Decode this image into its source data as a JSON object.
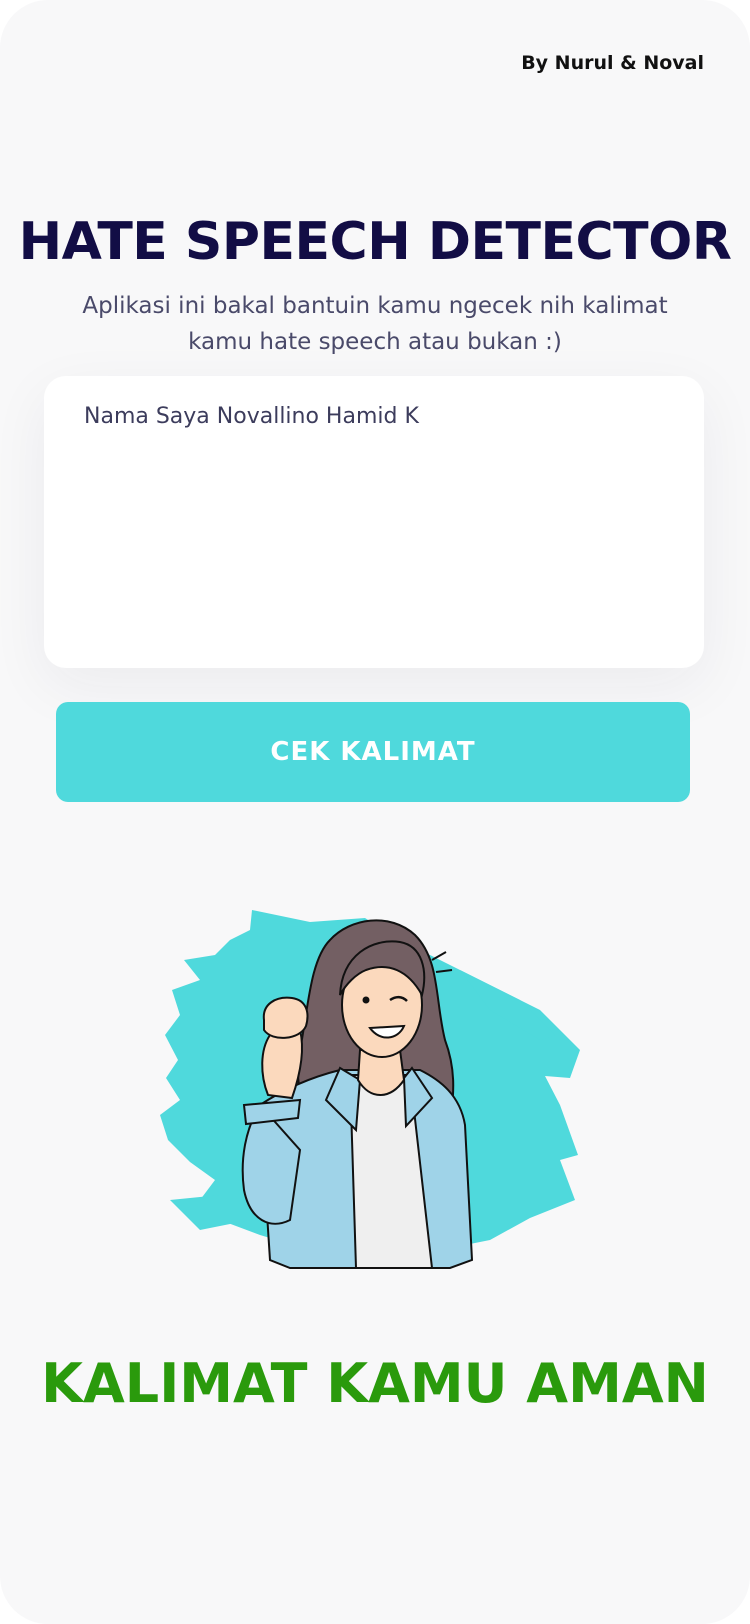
{
  "header": {
    "credit": "By Nurul & Noval"
  },
  "main": {
    "title": "HATE SPEECH DETECTOR",
    "subtitle": "Aplikasi ini bakal bantuin kamu ngecek nih kalimat kamu hate speech atau bukan :)",
    "input": {
      "value": "Nama Saya Novallino Hamid K"
    },
    "check_button_label": "CEK KALIMAT",
    "illustration_icon": "winking-woman-thumbs-up-illustration",
    "result_text": "KALIMAT KAMU AMAN"
  },
  "colors": {
    "accent": "#4fd9dc",
    "title": "#120d45",
    "result_safe": "#2a9a0c",
    "background": "#f8f8f9"
  }
}
